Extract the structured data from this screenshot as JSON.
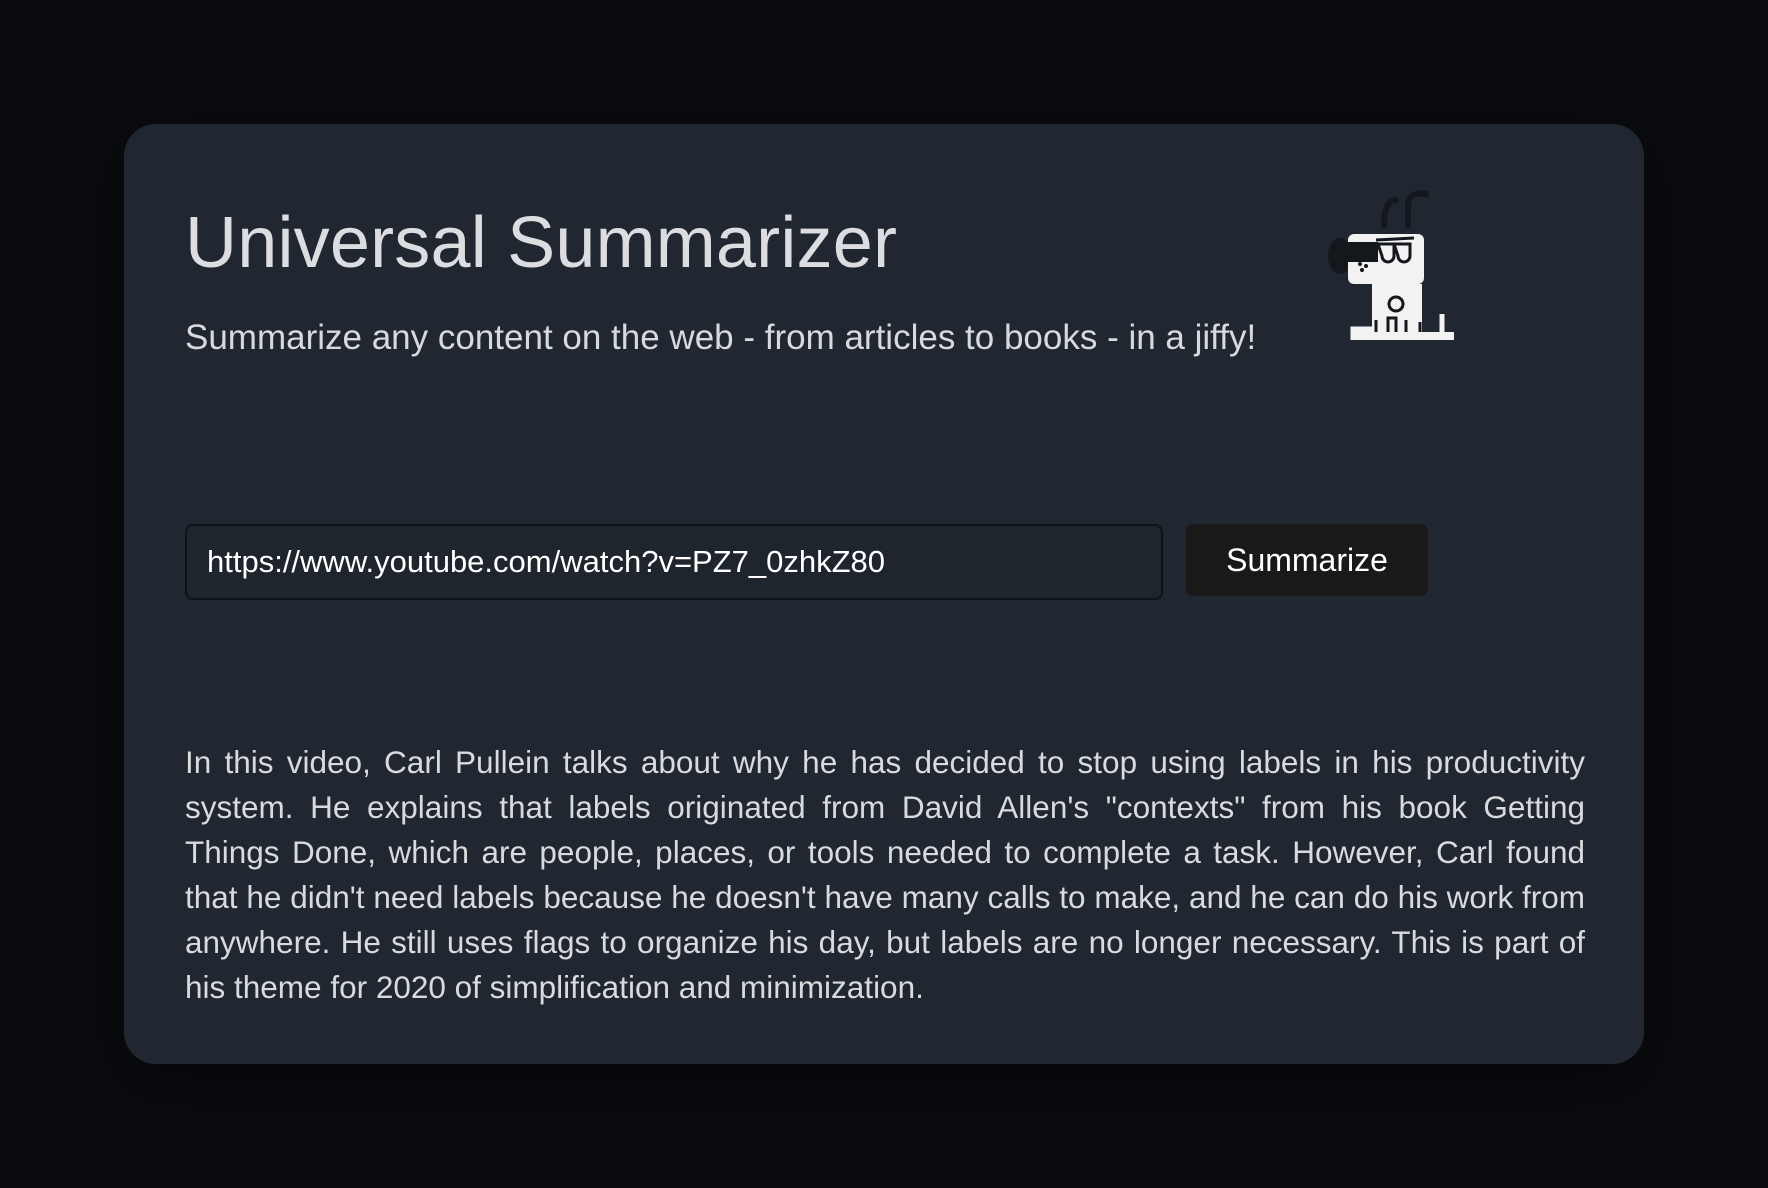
{
  "app": {
    "title": "Universal Summarizer",
    "subtitle": "Summarize any content on the web - from articles to books - in a jiffy!"
  },
  "mascot": {
    "icon": "robot-dog-icon"
  },
  "form": {
    "url_value": "https://www.youtube.com/watch?v=PZ7_0zhkZ80",
    "button_label": "Summarize"
  },
  "result": {
    "summary": "In this video, Carl Pullein talks about why he has decided to stop using labels in his productivity system. He explains that labels originated from David Allen's \"contexts\" from his book Getting Things Done, which are people, places, or tools needed to complete a task. However, Carl found that he didn't need labels because he doesn't have many calls to make, and he can do his work from anywhere. He still uses flags to organize his day, but labels are no longer necessary. This is part of his theme for 2020 of simplification and minimization."
  },
  "colors": {
    "page_background": "#0b0c10",
    "card_background": "#202730",
    "button_background": "#191919",
    "text": "#dcdde0"
  }
}
